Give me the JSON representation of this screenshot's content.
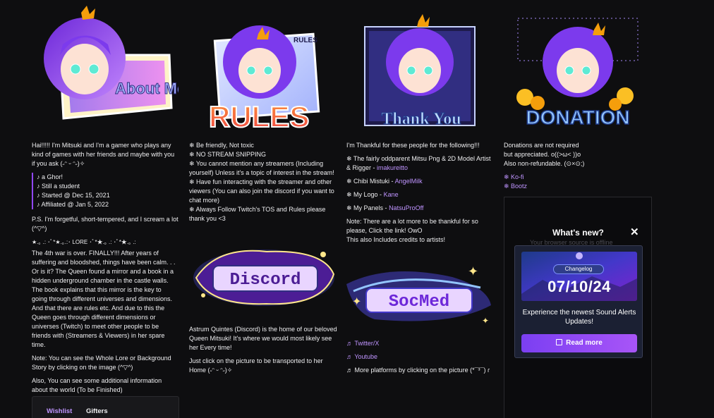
{
  "col1": {
    "banner_text": "About Me",
    "intro": "Hai!!!!! I'm Mitsuki and I'm a gamer who plays any kind of games with her friends and maybe with you if you ask (˶ᵔ ᵕ ᵔ˶)✧",
    "facts": [
      "♪ a Ghor!",
      "♪ Still a student",
      "♪ Started @ Dec 15, 2021",
      "♪ Affiliated @ Jan 5, 2022"
    ],
    "ps": "P.S. I'm forgetful, short-tempered, and I scream a lot (^▽^)",
    "lore_header": "★.｡ .: ･ﾟ*★.｡.:･ LORE ･ﾟ*★.｡ .: ･ﾟ*★.｡ .:",
    "lore": "The 4th war is over. FINALLY!!! After years of suffering and bloodshed, things have been calm. . . Or is it? The Queen found a mirror and a book in a hidden underground chamber in the castle walls. The book explains that this mirror is the key to going through different universes and dimensions. And that there are rules etc. And due to this the Queen goes through different dimensions or universes (Twitch) to meet other people to be friends with (Streamers & Viewers) in her spare time.",
    "note": "Note: You can see the Whole Lore or Background Story by clicking on the image (^▽^)",
    "also": "Also, You can see some additional information about the world (To be Finished)",
    "tabs": [
      "Wishlist",
      "Gifters"
    ]
  },
  "col2": {
    "banner_text": "RULES",
    "small_banner": "RULES",
    "rules": [
      "❄ Be friendly, Not toxic",
      "❄ NO STREAM SNIPPING",
      "❄ You cannot mention any streamers (Including yourself) Unless it's a topic of interest in the stream!",
      "❄ Have fun interacting with the streamer and other viewers (You can also join the discord if you want to chat more)",
      "❄ Always Follow Twitch's TOS and Rules please thank you <3"
    ],
    "discord_banner": "Discord",
    "discord_text": "Astrum Quintes (Discord) is the home of our beloved Queen Mitsuki! It's where we would most likely see her Every time!",
    "discord_cta": "Just click on the picture to be transported to her Home (˶ᵔ ᵕ ᵔ˶)✧"
  },
  "col3": {
    "banner_text": "Thank You",
    "intro": "I'm Thankful for these people for the following!!!",
    "credits": [
      {
        "label": "❄ The fairly oddparent Mitsu Png & 2D Model Artist & Rigger - ",
        "name": "imakureitto"
      },
      {
        "label": "❄ Chibi Mistuki - ",
        "name": "AngelMilk"
      },
      {
        "label": "❄ My Logo - ",
        "name": "Kane"
      },
      {
        "label": "❄ My Panels - ",
        "name": "NatsuProOff"
      }
    ],
    "note": "Note: There are a lot more to be thankful for so please, Click the link! OwO",
    "note2": "This also Includes credits to artists!",
    "socmed_banner": "SocMed",
    "links": [
      "♬ Twitter/X",
      "♬ Youtube"
    ],
    "more": "♬ More platforms by clicking on the picture (*¯³¯) ɾ"
  },
  "col4": {
    "banner_text": "DONATION",
    "line1": "Donations are not required",
    "line2": "but appreciated. o((>ω< ))o",
    "line3": "Also non-refundable. (⊙×⊙;)",
    "links": [
      "❄ Ko-fi",
      "❄ Bootz"
    ],
    "ghost_text": "Your browser source is offline",
    "popup": {
      "title": "What's new?",
      "close": "✕",
      "tag": "Changelog",
      "date": "07/10/24",
      "text": "Experience the newest Sound Alerts Updates!",
      "button": "Read more",
      "button_icon": "external-link-icon"
    }
  },
  "colors": {
    "accent": "#bf94ff",
    "background": "#0e0e10",
    "button": "#9147ff"
  }
}
